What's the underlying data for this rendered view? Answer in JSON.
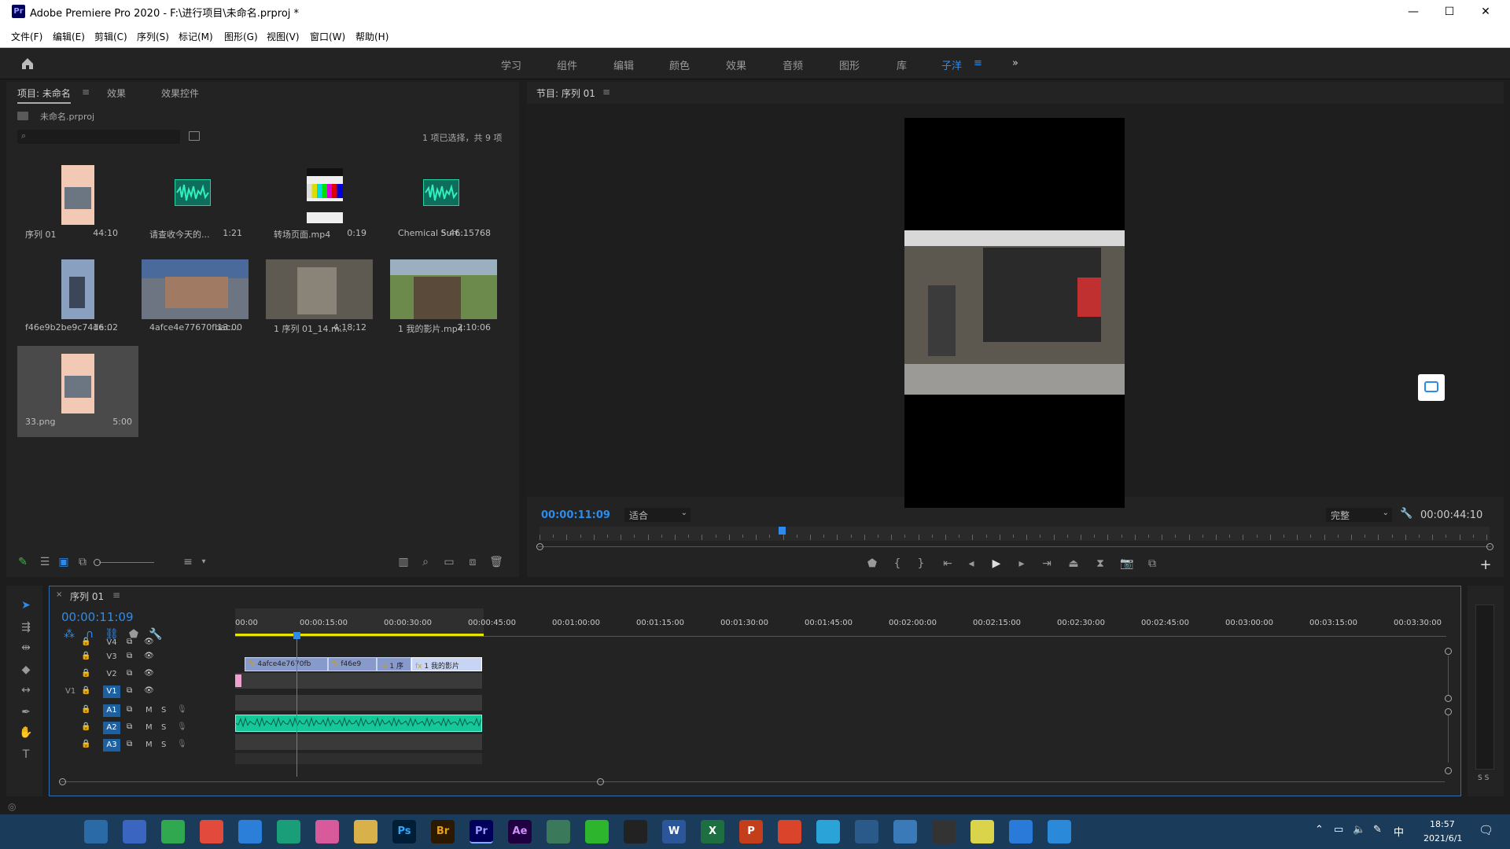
{
  "window": {
    "title": "Adobe Premiere Pro 2020 - F:\\进行项目\\未命名.prproj *",
    "app_icon_text": "Pr",
    "minimize": "—",
    "maximize": "☐",
    "close": "✕"
  },
  "menu": [
    "文件(F)",
    "编辑(E)",
    "剪辑(C)",
    "序列(S)",
    "标记(M)",
    "图形(G)",
    "视图(V)",
    "窗口(W)",
    "帮助(H)"
  ],
  "workspaces": [
    "学习",
    "组件",
    "编辑",
    "颜色",
    "效果",
    "音频",
    "图形",
    "库",
    "子洋"
  ],
  "workspace_more": "»",
  "project_panel": {
    "tabs": [
      "项目: 未命名",
      "效果",
      "效果控件"
    ],
    "project_file": "未命名.prproj",
    "selection_status": "1 项已选择，共 9 项",
    "items": [
      {
        "name": "序列 01",
        "duration": "44:10"
      },
      {
        "name": "请查收今天的...",
        "duration": "1:21"
      },
      {
        "name": "转场页面.mp4",
        "duration": "0:19"
      },
      {
        "name": "Chemical Surf...",
        "duration": "5:46:15768"
      },
      {
        "name": "f46e9b2be9c74de...",
        "duration": "16:02"
      },
      {
        "name": "4afce4e77670fbac...",
        "duration": "13:00"
      },
      {
        "name": "1 序列 01_14.m...",
        "duration": "4;18;12"
      },
      {
        "name": "1 我的影片.mp4",
        "duration": "2:10:06"
      },
      {
        "name": "33.png",
        "duration": "5:00"
      }
    ]
  },
  "program_monitor": {
    "tab": "节目: 序列 01",
    "current_timecode": "00:00:11:09",
    "zoom": "适合",
    "quality": "完整",
    "duration": "00:00:44:10",
    "playhead_fraction": 0.255
  },
  "timeline": {
    "tab": "序列 01",
    "timecode": "00:00:11:09",
    "ruler": [
      "00:00",
      "00:00:15:00",
      "00:00:30:00",
      "00:00:45:00",
      "00:01:00:00",
      "00:01:15:00",
      "00:01:30:00",
      "00:01:45:00",
      "00:02:00:00",
      "00:02:15:00",
      "00:02:30:00",
      "00:02:45:00",
      "00:03:00:00",
      "00:03:15:00",
      "00:03:30:00"
    ],
    "video_tracks": [
      "V4",
      "V3",
      "V2",
      "V1"
    ],
    "audio_tracks": [
      "A1",
      "A2",
      "A3"
    ],
    "source_patch": "V1",
    "mute": "M",
    "solo": "S",
    "clips_v2": [
      "4afce4e7670fb",
      "f46e9",
      "1 序",
      "1 我的影片"
    ],
    "clip_fx": "fx",
    "meter_labels": "S S"
  },
  "taskbar": {
    "time": "18:57",
    "date": "2021/6/1",
    "ime": "中",
    "icons": [
      "start-icon",
      "search-icon",
      "calculator-icon",
      "app-icon",
      "photos-icon",
      "chrome-icon",
      "edge-icon",
      "edge-new-icon",
      "paint-icon",
      "explorer-icon",
      "Ps",
      "Br",
      "Pr",
      "Ae",
      "app2-icon",
      "wechat-icon",
      "qq-icon",
      "W",
      "X",
      "P",
      "xmind-icon",
      "play-icon",
      "code-icon",
      "snip-icon",
      "obs-icon",
      "sun-icon",
      "feishu-icon",
      "monitor-icon"
    ]
  },
  "colors": {
    "accent": "#2d8ceb",
    "video_clip": "#a8b8d8",
    "audio_clip": "#1ed2a6",
    "work_area": "#e6e600"
  }
}
